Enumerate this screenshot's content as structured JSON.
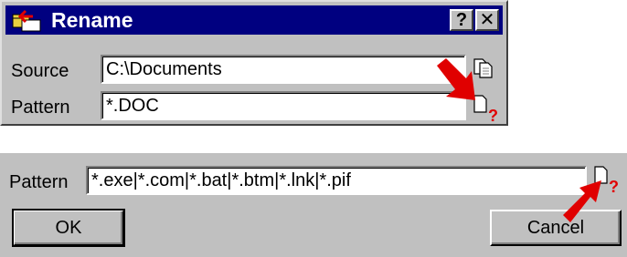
{
  "dialog": {
    "title": "Rename",
    "help_button": "?",
    "close_button": "✕",
    "source_label": "Source",
    "source_value": "C:\\Documents",
    "pattern_label": "Pattern",
    "pattern_value": "*.DOC",
    "source_icon": "copy-folder-icon",
    "pattern_icon": "pattern-help-icon"
  },
  "panel2": {
    "pattern_label": "Pattern",
    "pattern_value": "*.exe|*.com|*.bat|*.btm|*.lnk|*.pif",
    "ok_label": "OK",
    "cancel_label": "Cancel",
    "pattern_icon": "pattern-help-icon"
  },
  "colors": {
    "titlebar": "#000080",
    "face": "#c0c0c0",
    "arrow": "#e00000",
    "help_question": "#e00000"
  }
}
